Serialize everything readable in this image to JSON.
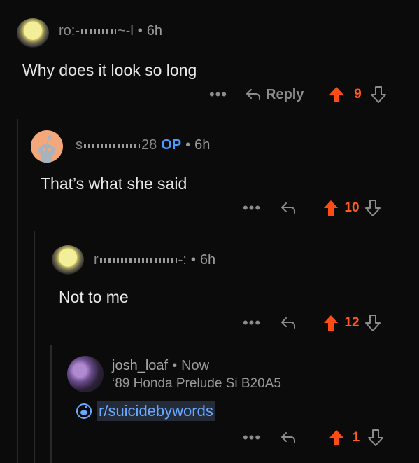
{
  "comments": [
    {
      "username": "ro:-",
      "username_tail": "~-l",
      "age": "6h",
      "body": "Why does it look so long",
      "reply_label": "Reply",
      "score": "9"
    },
    {
      "username": "s",
      "username_tail": "28",
      "op_badge": "OP",
      "age": "6h",
      "body": "That’s what she said",
      "score": "10"
    },
    {
      "username": "r",
      "username_tail": "-:",
      "age": "6h",
      "body": "Not to me",
      "score": "12"
    },
    {
      "username": "josh_loaf",
      "age": "Now",
      "flair": "‘89 Honda Prelude Si B20A5",
      "link": "r/suicidebywords",
      "score": "1"
    }
  ],
  "separator": "•",
  "more": "•••",
  "colors": {
    "upvote": "#ff4b16",
    "op_badge": "#4a9bff",
    "link": "#6aa8ff",
    "background": "#0b0b0b"
  }
}
